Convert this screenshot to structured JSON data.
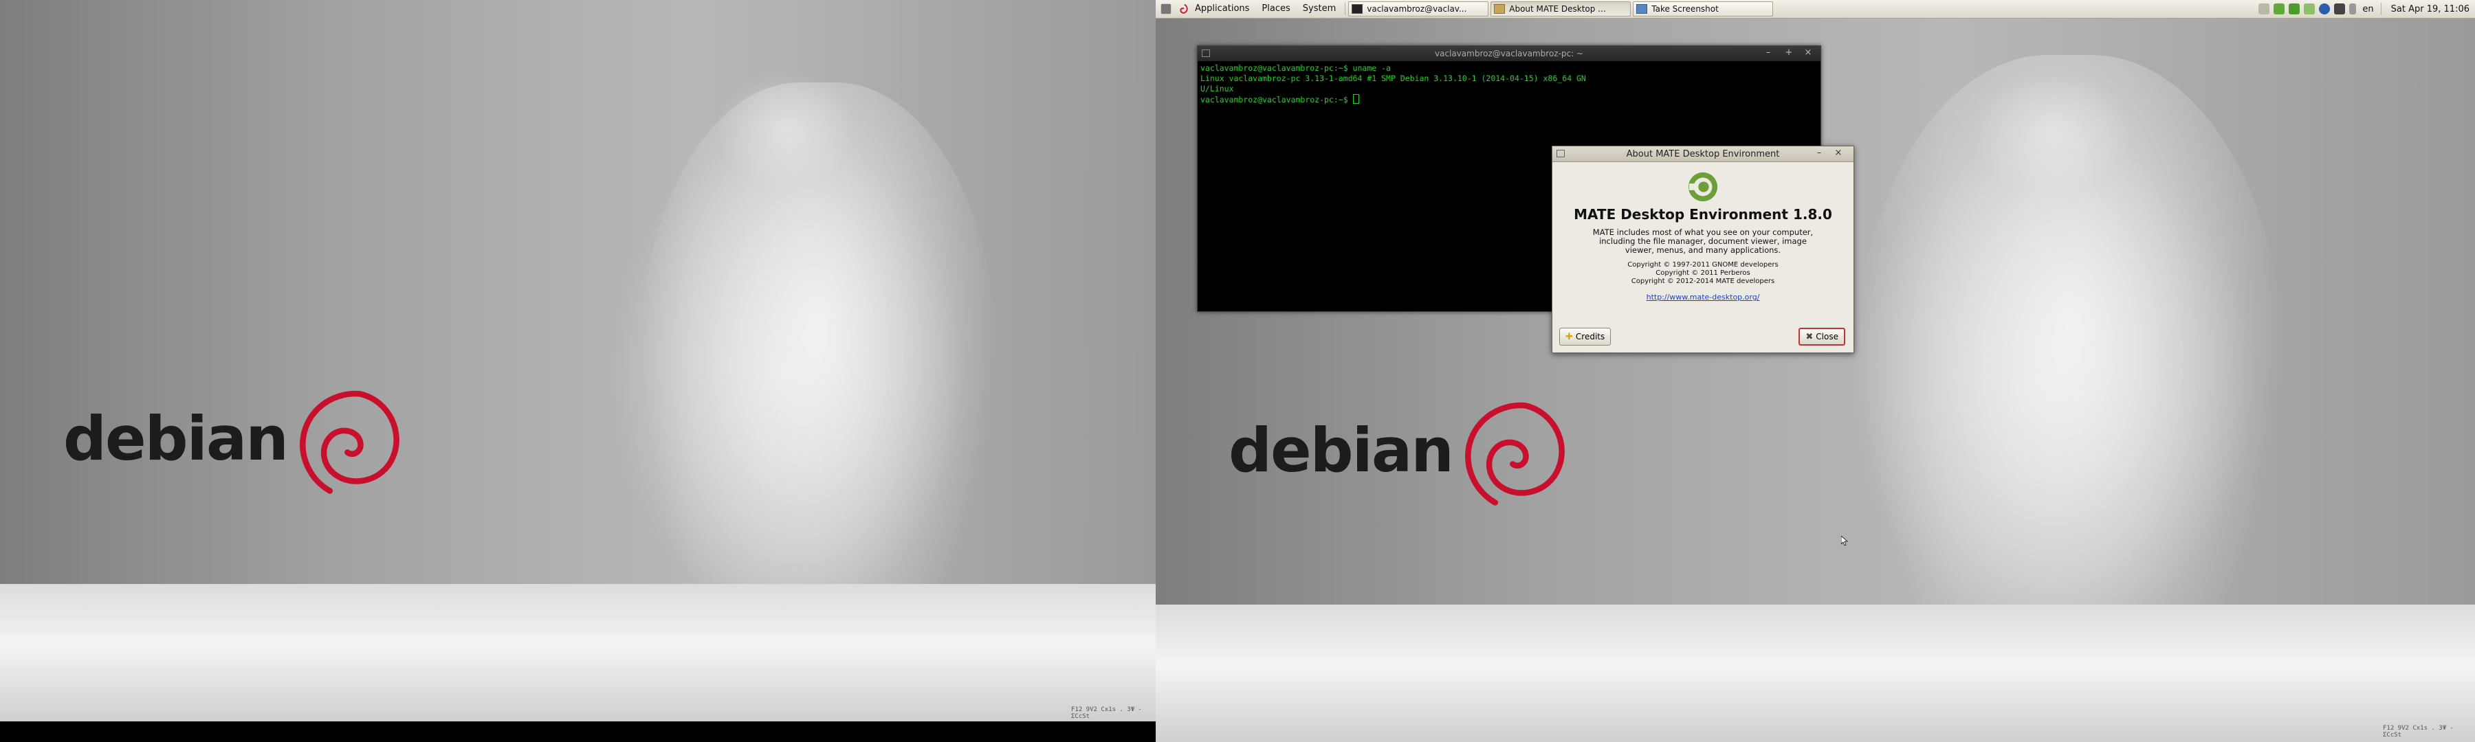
{
  "left_screen": {
    "wallpaper_logo": "debian",
    "corner_tag": "F12 9V2 Cx1s . 3Ψ - ΣCcSt"
  },
  "right_screen": {
    "wallpaper_logo": "debian",
    "corner_tag": "F12 9V2 Cx1s . 3Ψ - ΣCcSt"
  },
  "panel": {
    "menus": [
      "Applications",
      "Places",
      "System"
    ],
    "tasks": [
      {
        "label": "vaclavambroz@vaclav...",
        "icon": "terminal-icon"
      },
      {
        "label": "About MATE Desktop ...",
        "icon": "folder-icon"
      },
      {
        "label": "Take Screenshot",
        "icon": "screenshot-icon"
      }
    ],
    "keyboard_layout": "en",
    "clock": "Sat Apr 19, 11:06"
  },
  "terminal": {
    "title": "vaclavambroz@vaclavambroz-pc: ~",
    "lines": [
      "vaclavambroz@vaclavambroz-pc:~$ uname -a",
      "Linux vaclavambroz-pc 3.13-1-amd64 #1 SMP Debian 3.13.10-1 (2014-04-15) x86_64 GN",
      "U/Linux",
      "vaclavambroz@vaclavambroz-pc:~$ "
    ]
  },
  "about_dialog": {
    "title": "About MATE Desktop Environment",
    "name": "MATE Desktop Environment 1.8.0",
    "description": "MATE includes most of what you see on your computer, including the file manager, document viewer, image viewer, menus, and many applications.",
    "copyright": [
      "Copyright © 1997-2011 GNOME developers",
      "Copyright © 2011 Perberos",
      "Copyright © 2012-2014 MATE developers"
    ],
    "link": "http://www.mate-desktop.org/",
    "credits_label": "Credits",
    "close_label": "Close"
  },
  "colors": {
    "terminal_text": "#22d022",
    "debian_red": "#c8102e",
    "mate_green": "#6d9e3a",
    "link": "#1b3fd6"
  }
}
